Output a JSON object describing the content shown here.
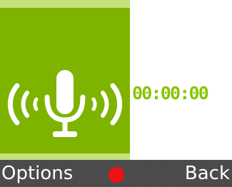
{
  "recorder": {
    "timer": "00:00:00",
    "icon": "microphone-icon"
  },
  "softkeys": {
    "left_label": "Options",
    "right_label": "Back",
    "center_icon": "record-dot-icon"
  },
  "colors": {
    "accent_green": "#7eb300",
    "light_green": "#c6e07e",
    "timer_green": "#88c400",
    "softkey_bar": "#4a4a4a",
    "record_red": "#ee1111"
  }
}
